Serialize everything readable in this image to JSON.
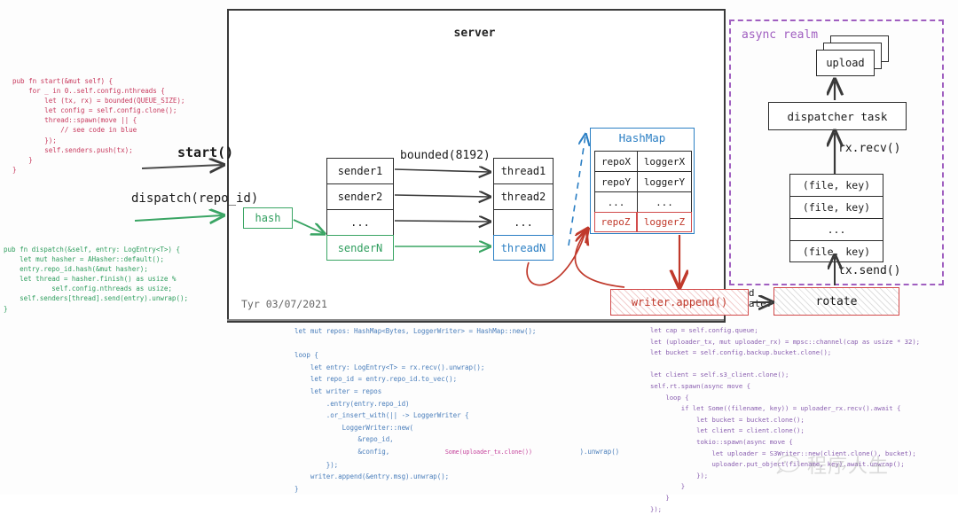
{
  "diagram": {
    "title": "server",
    "signature": "Tyr 03/07/2021",
    "watermark": "程序人生"
  },
  "colors": {
    "start_code": "#c83a5e",
    "dispatch_code": "#2f9e5e",
    "loop_code": "#4a7ebb",
    "upload_code": "#8a5fb0",
    "green": "#2f9e5e",
    "blue": "#2b7fc4",
    "red": "#c0392b",
    "purple": "#a05fc0",
    "black": "#2b2b2b"
  },
  "code_blocks": {
    "start": "pub fn start(&mut self) {\n    for _ in 0..self.config.nthreads {\n        let (tx, rx) = bounded(QUEUE_SIZE);\n        let config = self.config.clone();\n        thread::spawn(move || {\n            // see code in blue\n        });\n        self.senders.push(tx);\n    }\n}",
    "dispatch": "pub fn dispatch(&self, entry: LogEntry<T>) {\n    let mut hasher = AHasher::default();\n    entry.repo_id.hash(&mut hasher);\n    let thread = hasher.finish() as usize %\n            self.config.nthreads as usize;\n    self.senders[thread].send(entry).unwrap();\n}",
    "loop_head": "let mut repos: HashMap<Bytes, LoggerWriter> = HashMap::new();\n\nloop {\n    let entry: LogEntry<T> = rx.recv().unwrap();\n    let repo_id = entry.repo_id.to_vec();\n    let writer = repos\n        .entry(entry.repo_id)\n        .or_insert_with(|| -> LoggerWriter {\n            LoggerWriter::new(\n                &repo_id,\n                &config,",
    "loop_highlight": "                Some(uploader_tx.clone())",
    "loop_tail": "            ).unwrap()\n        });\n    writer.append(&entry.msg).unwrap();\n}",
    "upload": "let cap = self.config.queue;\nlet (uploader_tx, mut uploader_rx) = mpsc::channel(cap as usize * 32);\nlet bucket = self.config.backup.bucket.clone();\n\nlet client = self.s3_client.clone();\nself.rt.spawn(async move {\n    loop {\n        if let Some((filename, key)) = uploader_rx.recv().await {\n            let bucket = bucket.clone();\n            let client = client.clone();\n            tokio::spawn(async move {\n                let uploader = S3Writer::new(client.clone(), bucket);\n                uploader.put_object(filename, key).await.unwrap();\n            });\n        }\n    }\n});"
  },
  "labels": {
    "start_arrow": "start()",
    "dispatch_arrow": "dispatch(repo_id)",
    "bounded": "bounded(8192)",
    "rx_recv": "rx.recv()",
    "tx_send": "tx.send()",
    "need_rotate": "need\nrotate?",
    "hash": "hash"
  },
  "senders": [
    "sender1",
    "sender2",
    "...",
    "senderN"
  ],
  "threads": [
    "thread1",
    "thread2",
    "...",
    "threadN"
  ],
  "hashmap": {
    "title": "HashMap",
    "rows": [
      {
        "key": "repoX",
        "value": "loggerX"
      },
      {
        "key": "repoY",
        "value": "loggerY"
      },
      {
        "key": "...",
        "value": "..."
      },
      {
        "key": "repoZ",
        "value": "loggerZ"
      }
    ]
  },
  "async_realm": {
    "label": "async realm",
    "upload": "upload",
    "dispatcher_task": "dispatcher task",
    "queue": [
      "(file, key)",
      "(file, key)",
      "...",
      "(file, key)"
    ]
  },
  "bottom": {
    "writer_append": "writer.append()",
    "rotate": "rotate"
  }
}
